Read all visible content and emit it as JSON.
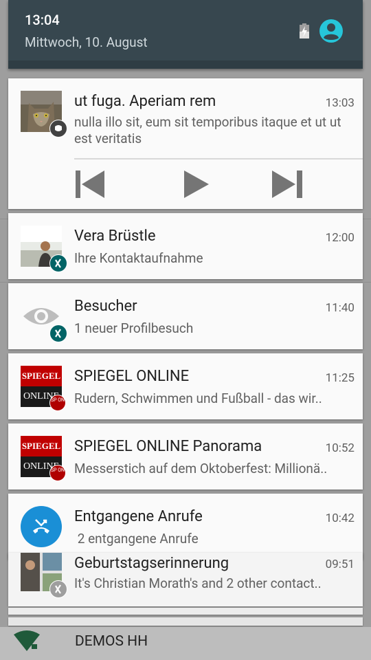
{
  "status": {
    "time": "13:04",
    "date": "Mittwoch, 10. August"
  },
  "notifications": [
    {
      "id": "media",
      "title": "ut fuga. Aperiam rem",
      "time": "13:03",
      "text": "nulla illo sit, eum sit temporibus itaque et ut ut est veritatis",
      "icon": "cat-photo"
    },
    {
      "id": "vera",
      "title": "Vera Brüstle",
      "time": "12:00",
      "text": "Ihre Kontaktaufnahme",
      "icon": "person-photo",
      "badge": "xing-icon"
    },
    {
      "id": "besucher",
      "title": "Besucher",
      "time": "11:40",
      "text": "1 neuer Profilbesuch",
      "icon": "eye-icon",
      "badge": "xing-icon"
    },
    {
      "id": "spiegel1",
      "title": "SPIEGEL ONLINE",
      "time": "11:25",
      "text": "Rudern, Schwimmen und Fußball - das wir..",
      "icon": "spiegel-logo",
      "badge": "spiegel-badge"
    },
    {
      "id": "spiegel2",
      "title": "SPIEGEL ONLINE Panorama",
      "time": "10:52",
      "text": "Messerstich auf dem Oktoberfest: Millionä..",
      "icon": "spiegel-logo",
      "badge": "spiegel-badge"
    },
    {
      "id": "calls",
      "title": "Entgangene Anrufe",
      "time": "10:42",
      "text": " 2 entgangene Anrufe",
      "icon": "missed-call-icon"
    },
    {
      "id": "birthday",
      "title": "Geburtstagserinnerung",
      "time": "09:51",
      "text": "It's Christian Morath's and 2 other contact..",
      "icon": "people-collage",
      "badge": "xing-icon"
    }
  ],
  "spiegel_logo_top": "SPIEGEL",
  "spiegel_logo_bottom": "ONLINE",
  "spiegel_badge_text": "SP ON",
  "carrier": "DEMOS HH",
  "colors": {
    "header": "#37474f",
    "xing": "#026466",
    "spiegel_red": "#c00000",
    "call_blue": "#1a8fd6",
    "user_icon": "#26c6da"
  }
}
